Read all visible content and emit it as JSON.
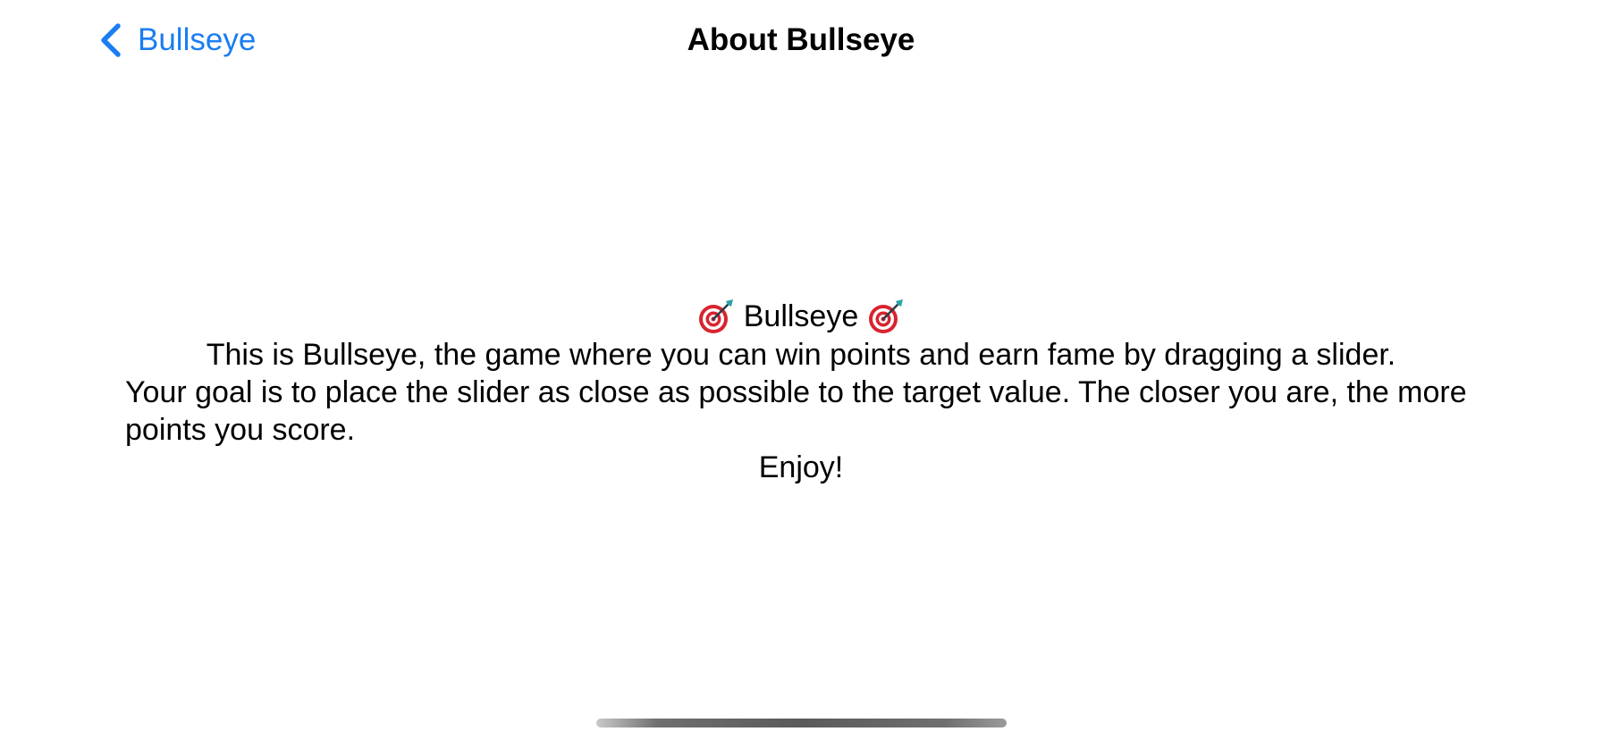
{
  "nav": {
    "back_label": "Bullseye",
    "title": "About Bullseye"
  },
  "content": {
    "heading": "Bullseye",
    "heading_icon": "target-dart-emoji",
    "intro": "This is Bullseye, the game where you can win points and earn fame by dragging a slider.",
    "goal": "Your goal is to place the slider as close as possible to the target value. The closer you are, the more points you score.",
    "closing": "Enjoy!"
  },
  "colors": {
    "accent": "#1b7df2",
    "text": "#000000",
    "background": "#ffffff"
  }
}
